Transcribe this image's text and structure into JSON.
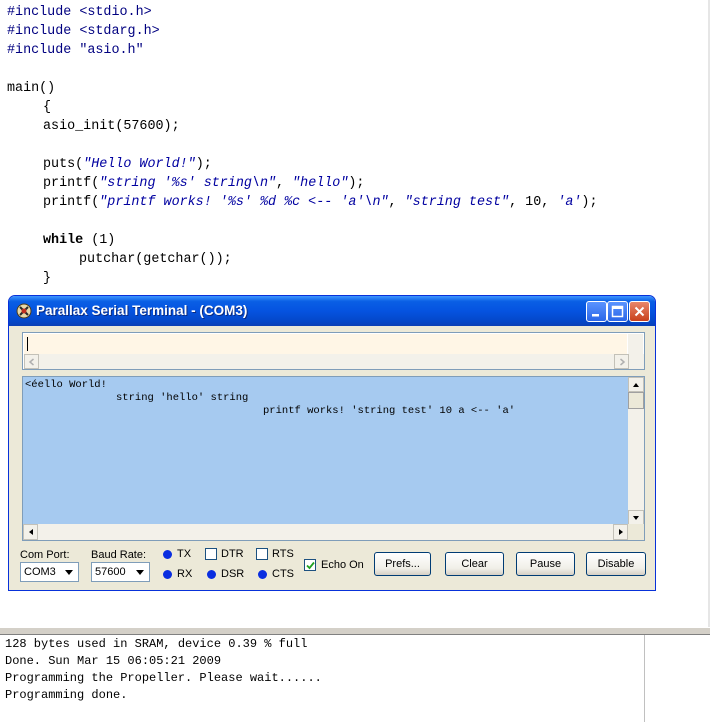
{
  "editor": {
    "lines": [
      {
        "pre": "#include ",
        "body": "<stdio.h>"
      },
      {
        "pre": "#include ",
        "body": "<stdarg.h>"
      },
      {
        "pre": "#include ",
        "body": "\"asio.h\""
      },
      {
        "pre": "",
        "body": "main()"
      },
      {
        "pre": "",
        "body": "{"
      },
      {
        "pre": "",
        "body": "asio_init(57600);"
      },
      {
        "pre": "",
        "body": "puts(",
        "str": "\"Hello World!\"",
        "post": ");"
      },
      {
        "pre": "",
        "body": "printf(",
        "str": "\"string '%s' string\\n\"",
        "post": ", ",
        "str2": "\"hello\"",
        "post2": ");"
      },
      {
        "pre": "",
        "body": "printf(",
        "str": "\"printf works! '%s' %d %c <-- 'a'\\n\"",
        "post": ", ",
        "str2": "\"string test\"",
        "post2": ", 10, ",
        "str3": "'a'",
        "post3": ");"
      },
      {
        "pre": "",
        "bold": "while",
        "body": " (1)"
      },
      {
        "pre": "",
        "body": "putchar(getchar());"
      },
      {
        "pre": "",
        "body": "}"
      }
    ]
  },
  "terminal": {
    "title": "Parallax Serial Terminal - (COM3)",
    "transmit_value": "",
    "receive_lines": [
      "<éello World!",
      "string 'hello' string",
      "printf works! 'string test' 10 a <-- 'a'"
    ],
    "com_port_label": "Com Port:",
    "com_port_value": "COM3",
    "baud_rate_label": "Baud Rate:",
    "baud_rate_value": "57600",
    "indicators": {
      "tx": "TX",
      "rx": "RX",
      "dtr": "DTR",
      "dsr": "DSR",
      "rts": "RTS",
      "cts": "CTS"
    },
    "echo_label": "Echo On",
    "echo_checked": true,
    "buttons": {
      "prefs": "Prefs...",
      "clear": "Clear",
      "pause": "Pause",
      "disable": "Disable"
    },
    "colors": {
      "receive_bg": "#a6caf0",
      "transmit_bg": "#fff6e6",
      "led": "#0a2ee0"
    }
  },
  "output": {
    "lines": [
      "128 bytes used in SRAM, device 0.39 % full",
      "Done. Sun Mar 15 06:05:21 2009",
      "Programming the Propeller. Please wait......",
      "Programming done."
    ]
  }
}
